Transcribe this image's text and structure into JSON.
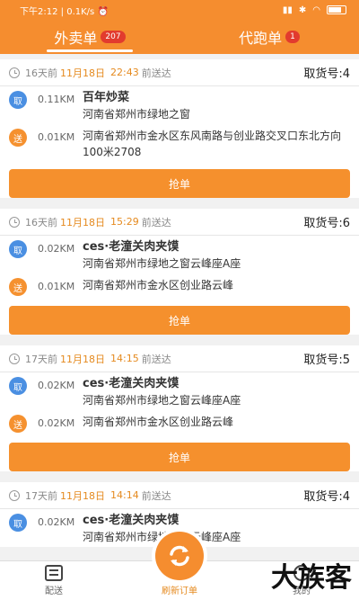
{
  "status": {
    "time": "下午2:12",
    "speed": "0.1K/s"
  },
  "tabs": [
    {
      "label": "外卖单",
      "badge": "207"
    },
    {
      "label": "代跑单",
      "badge": "1"
    }
  ],
  "orders": [
    {
      "days": "16天",
      "date": "11月18日",
      "time": "22:43",
      "suffix": "前送达",
      "pick_code": "取货号:4",
      "pickup": {
        "tag": "取",
        "distance": "0.11KM",
        "shop": "百年炒菜",
        "address": "河南省郑州市绿地之窗"
      },
      "delivery": {
        "tag": "送",
        "distance": "0.01KM",
        "address": "河南省郑州市金水区东风南路与创业路交叉口东北方向100米2708"
      },
      "button": "抢单"
    },
    {
      "days": "16天",
      "date": "11月18日",
      "time": "15:29",
      "suffix": "前送达",
      "pick_code": "取货号:6",
      "pickup": {
        "tag": "取",
        "distance": "0.02KM",
        "shop": "ces·老潼关肉夹馍",
        "address": "河南省郑州市绿地之窗云峰座A座"
      },
      "delivery": {
        "tag": "送",
        "distance": "0.01KM",
        "address": "河南省郑州市金水区创业路云峰"
      },
      "button": "抢单"
    },
    {
      "days": "17天",
      "date": "11月18日",
      "time": "14:15",
      "suffix": "前送达",
      "pick_code": "取货号:5",
      "pickup": {
        "tag": "取",
        "distance": "0.02KM",
        "shop": "ces·老潼关肉夹馍",
        "address": "河南省郑州市绿地之窗云峰座A座"
      },
      "delivery": {
        "tag": "送",
        "distance": "0.02KM",
        "address": "河南省郑州市金水区创业路云峰"
      },
      "button": "抢单"
    },
    {
      "days": "17天",
      "date": "11月18日",
      "time": "14:14",
      "suffix": "前送达",
      "pick_code": "取货号:4",
      "pickup": {
        "tag": "取",
        "distance": "0.02KM",
        "shop": "ces·老潼关肉夹馍",
        "address": "河南省郑州市绿地之窗云峰座A座"
      }
    }
  ],
  "bottom": {
    "left_label": "配送",
    "center_label": "刷新订单",
    "right_label": "我的"
  },
  "watermark": "大族客",
  "colors": {
    "accent": "#f58d2f",
    "pickup_tag": "#4a8fe2",
    "delivery_tag": "#f5912f",
    "highlight": "#e58a1f"
  }
}
